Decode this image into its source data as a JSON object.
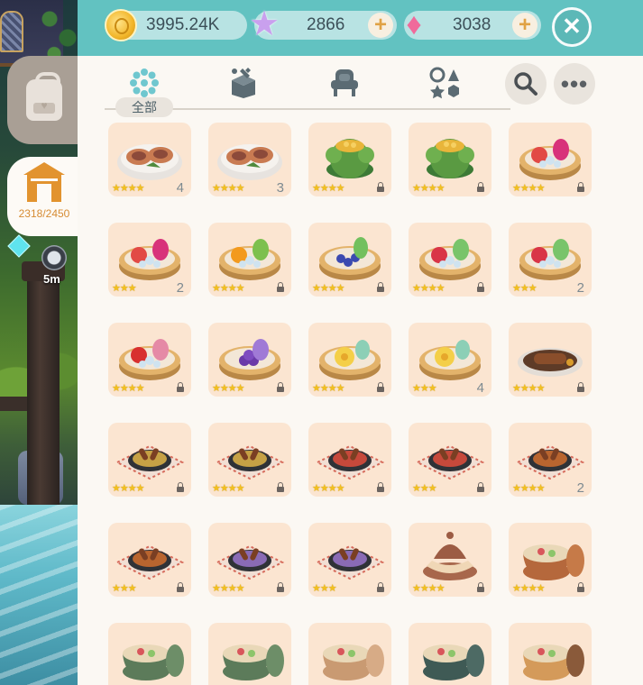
{
  "currencies": {
    "coins": "3995.24K",
    "stars": "2866",
    "gems": "3038"
  },
  "sidebar": {
    "build_count": "2318/2450",
    "timer": "5m"
  },
  "categories": {
    "active_label": "全部",
    "tabs": [
      "all-icon",
      "crafting-icon",
      "furniture-icon",
      "shapes-icon"
    ]
  },
  "items": [
    {
      "dish": "fish-plate",
      "stars": "★★★★",
      "qty": "4"
    },
    {
      "dish": "fish-plate",
      "stars": "★★★★",
      "qty": "3"
    },
    {
      "dish": "cactus-bowl",
      "stars": "★★★★",
      "qty": ""
    },
    {
      "dish": "cactus-bowl",
      "stars": "★★★★",
      "qty": ""
    },
    {
      "dish": "apple-dragonfruit-tart",
      "stars": "★★★★",
      "qty": ""
    },
    {
      "dish": "apple-dragonfruit-tart",
      "stars": "★★★",
      "qty": "2"
    },
    {
      "dish": "orange-tart",
      "stars": "★★★★",
      "qty": ""
    },
    {
      "dish": "blueberry-tart",
      "stars": "★★★★",
      "qty": ""
    },
    {
      "dish": "berry-cactus-tart",
      "stars": "★★★★",
      "qty": ""
    },
    {
      "dish": "berry-cactus-tart",
      "stars": "★★★",
      "qty": "2"
    },
    {
      "dish": "strawberry-tart",
      "stars": "★★★★",
      "qty": ""
    },
    {
      "dish": "grape-tart",
      "stars": "★★★★",
      "qty": ""
    },
    {
      "dish": "flower-tart",
      "stars": "★★★★",
      "qty": ""
    },
    {
      "dish": "flower-tart",
      "stars": "★★★",
      "qty": "4"
    },
    {
      "dish": "steak-plate",
      "stars": "★★★★",
      "qty": ""
    },
    {
      "dish": "grilled-platter",
      "stars": "★★★★",
      "qty": ""
    },
    {
      "dish": "grilled-platter",
      "stars": "★★★★",
      "qty": ""
    },
    {
      "dish": "red-grill-platter",
      "stars": "★★★★",
      "qty": ""
    },
    {
      "dish": "red-grill-platter",
      "stars": "★★★",
      "qty": ""
    },
    {
      "dish": "spicy-grill-platter",
      "stars": "★★★★",
      "qty": "2"
    },
    {
      "dish": "spicy-grill-platter",
      "stars": "★★★",
      "qty": ""
    },
    {
      "dish": "purple-grill-platter",
      "stars": "★★★★",
      "qty": ""
    },
    {
      "dish": "purple-grill-platter",
      "stars": "★★★",
      "qty": ""
    },
    {
      "dish": "tagine",
      "stars": "★★★★",
      "qty": ""
    },
    {
      "dish": "clay-pot-stew",
      "stars": "★★★★",
      "qty": ""
    },
    {
      "dish": "green-pot-stew",
      "stars": "",
      "qty": ""
    },
    {
      "dish": "green-pot-stew",
      "stars": "",
      "qty": ""
    },
    {
      "dish": "clay-pot-soup",
      "stars": "",
      "qty": ""
    },
    {
      "dish": "dark-pot-soup",
      "stars": "",
      "qty": ""
    },
    {
      "dish": "clay-pot-curry",
      "stars": "",
      "qty": ""
    }
  ],
  "colors": {
    "topbar": "#62c2c1",
    "panel": "#fbf8f3",
    "cell": "#fbe5d1",
    "accent": "#e2932f"
  }
}
